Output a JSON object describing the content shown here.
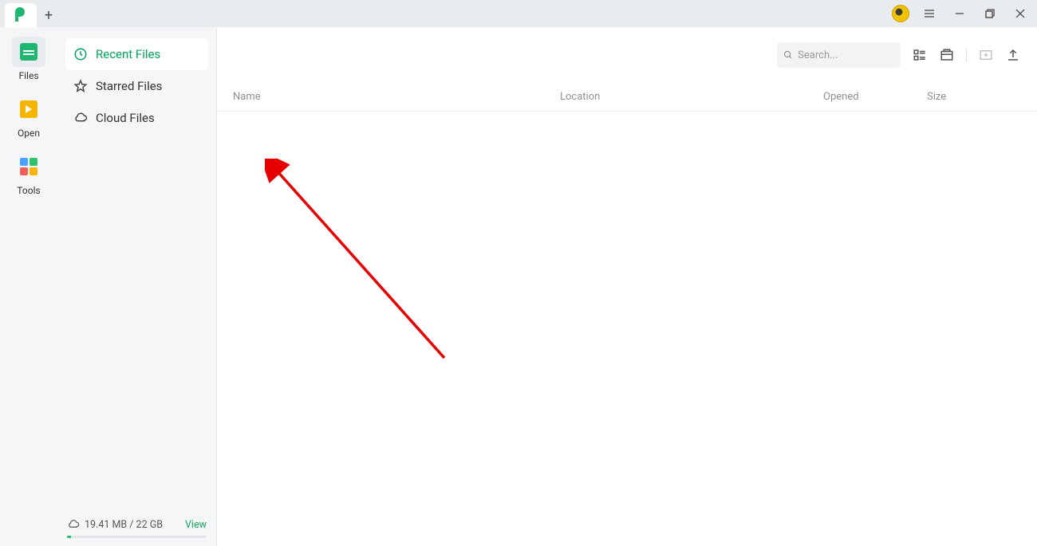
{
  "titlebar": {
    "new_tab": "+"
  },
  "rail": {
    "files": "Files",
    "open": "Open",
    "tools": "Tools"
  },
  "sidebar": {
    "recent": "Recent Files",
    "starred": "Starred Files",
    "cloud": "Cloud Files"
  },
  "storage": {
    "text": "19.41 MB / 22 GB",
    "view": "View"
  },
  "search": {
    "placeholder": "Search..."
  },
  "columns": {
    "name": "Name",
    "location": "Location",
    "opened": "Opened",
    "size": "Size"
  }
}
